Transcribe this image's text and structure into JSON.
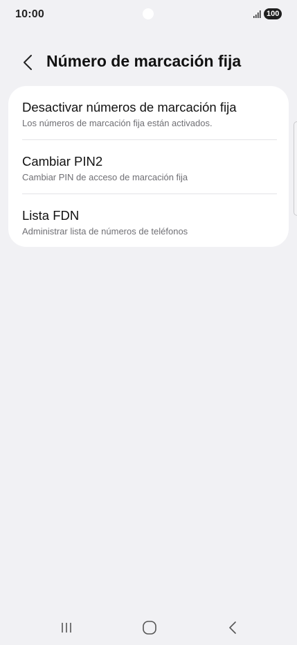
{
  "status_bar": {
    "time": "10:00",
    "battery": "100",
    "icons": [
      "signal-icon",
      "battery-icon",
      "camera-icon"
    ]
  },
  "header": {
    "back_icon": "chevron-left-icon",
    "title": "Número de marcación fija"
  },
  "settings": {
    "items": [
      {
        "title": "Desactivar números de marcación fija",
        "subtitle": "Los números de marcación fija están activados."
      },
      {
        "title": "Cambiar PIN2",
        "subtitle": "Cambiar PIN de acceso de marcación fija"
      },
      {
        "title": "Lista FDN",
        "subtitle": "Administrar lista de números de teléfonos"
      }
    ]
  },
  "navigation_bar": {
    "icons": [
      "recents-icon",
      "home-icon",
      "back-icon"
    ]
  },
  "colors": {
    "background": "#f1f1f4",
    "card": "#ffffff",
    "text_primary": "#111111",
    "text_secondary": "#6f6f74"
  }
}
